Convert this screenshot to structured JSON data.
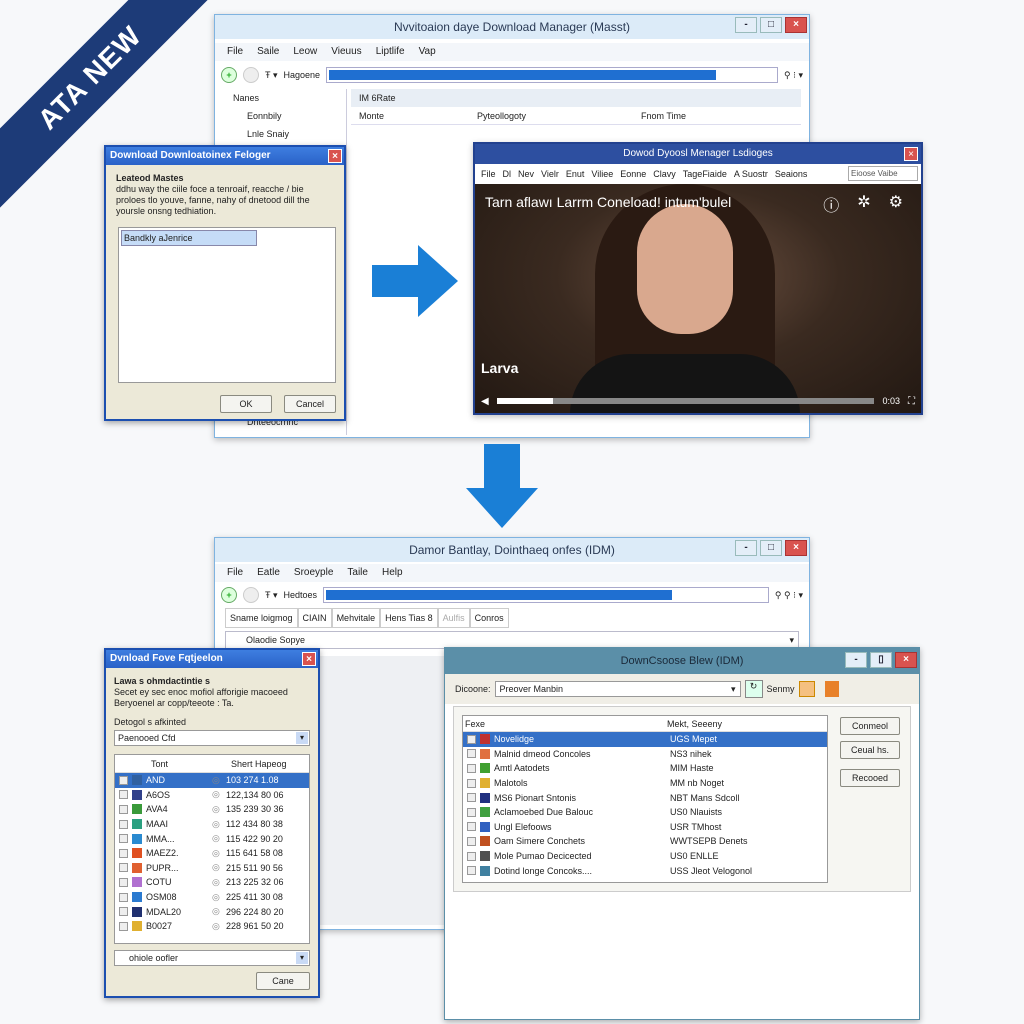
{
  "banner": {
    "text": "ATA NEW"
  },
  "top_window": {
    "title": "Nvvitoaion daye Download Manager  (Masst)",
    "menu": [
      "File",
      "Saile",
      "Leow",
      "Vieuus",
      "Liptlife",
      "Vap"
    ],
    "toolbar_label": "Hagoene",
    "progress": 0.88,
    "tree": [
      "Nanes",
      "Eonnbily",
      "Lnle Snaiy",
      "Dnteeocrnnc"
    ],
    "content_header": "IM 6Rate",
    "columns": [
      "Monte",
      "Pyteollogoty",
      "Fnom Time"
    ]
  },
  "dialog1": {
    "title": "Download Downloatoinex Feloger",
    "heading": "Leateod Mastes",
    "description": "ddhu way the ciile foce a tenroaif, reacche / bie proloes tlo youve, fanne, nahy of dnetood dill the yoursle onsng tedhiation.",
    "list_item": "Bandkly aJenrice",
    "ok": "OK",
    "cancel": "Cancel"
  },
  "video_window": {
    "title": "Dowod Dyoosl Menager Lsdioges",
    "menu": [
      "File",
      "Dl",
      "Nev",
      "Vielr",
      "Enut",
      "Viliee",
      "Eonne",
      "Clavy",
      "TageFiaide",
      "A Suostr",
      "Seaions"
    ],
    "search": "Eioose Vaibe",
    "overlay_title": "Tarn aflawı Larrm Coneload! intum'bulel",
    "caption": "Larva",
    "progress": 0.15,
    "time": "0:03"
  },
  "bottom_window": {
    "title": "Damor Bantlay, Dointhaeq onfes (IDM)",
    "menu": [
      "File",
      "Eatle",
      "Sroeyple",
      "Taile",
      "Help"
    ],
    "toolbar_label": "Hedtoes",
    "progress": 0.83,
    "tabs": [
      "Sname loigmog",
      "CIAIN",
      "Mehvitale",
      "Hens Tias 8",
      "Aulfis",
      "Conros"
    ],
    "address": "Olaodie Sopye"
  },
  "dialog2": {
    "title": "Dvnload Fove Fqtjeelon",
    "heading": "Lawa s ohmdactintie s",
    "description": "Secet ey sec enoc mofiol afforigie macoeed Beryoenel ar copp/teeote : Ta.",
    "field_label": "Detogol s afkinted",
    "dropdown": "Paenooed Cfd",
    "columns": [
      "Tont",
      "Shert Hapeog"
    ],
    "rows": [
      {
        "name": "AND",
        "value": "103 274 1.08",
        "color": "#3060a0"
      },
      {
        "name": "A6OS",
        "value": "122,134 80 06",
        "color": "#30408a"
      },
      {
        "name": "AVA4",
        "value": "135 239 30 36",
        "color": "#3a9a3a"
      },
      {
        "name": "MAAI",
        "value": "112 434 80 38",
        "color": "#2aa080"
      },
      {
        "name": "MMA...",
        "value": "115 422 90 20",
        "color": "#2a8ad0"
      },
      {
        "name": "MAEZ2.",
        "value": "115 641 58 08",
        "color": "#e05020"
      },
      {
        "name": "PUPR...",
        "value": "215 511 90 56",
        "color": "#e06030"
      },
      {
        "name": "COTU",
        "value": "213 225 32 06",
        "color": "#b070d0"
      },
      {
        "name": "OSM08",
        "value": "225 411 30 08",
        "color": "#2a7ad0"
      },
      {
        "name": "MDAL20",
        "value": "296 224 80 20",
        "color": "#203070"
      },
      {
        "name": "B0027",
        "value": "228 961 50 20",
        "color": "#e0b030"
      }
    ],
    "bottom_dropdown": "ohiole oofler",
    "cancel": "Cane"
  },
  "dialog3": {
    "title": "DownCsoose Blew (IDM)",
    "field_label": "Dicoone:",
    "dropdown": "Preover Manbin",
    "secondary_label": "Senmy",
    "columns": [
      "Fexe",
      "Mekt, Seeeny"
    ],
    "rows": [
      {
        "name": "Novelidge",
        "value": "UGS Mepet",
        "color": "#c03030"
      },
      {
        "name": "Malnid dmeod Concoles",
        "value": "NS3 nihek",
        "color": "#e07040"
      },
      {
        "name": "Amtl Aatodets",
        "value": "MIM Haste",
        "color": "#40a030"
      },
      {
        "name": "Malotols",
        "value": "MM nb Noget",
        "color": "#e0b030"
      },
      {
        "name": "MS6 Pionart Sntonis",
        "value": "NBT Mans Sdcoll",
        "color": "#203080"
      },
      {
        "name": "Aclamoebed Due Balouc",
        "value": "US0 Nlauists",
        "color": "#40a040"
      },
      {
        "name": "Ungl Elefoows",
        "value": "USR TMhost",
        "color": "#3060c0"
      },
      {
        "name": "Oam Simere Conchets",
        "value": "WWTSEPB Denets",
        "color": "#c05020"
      },
      {
        "name": "Mole Pumao Decicected",
        "value": "US0 ENLLE",
        "color": "#505050"
      },
      {
        "name": "Dotind longe Concoks....",
        "value": "USS Jleot Velogonol",
        "color": "#4080a0"
      }
    ],
    "buttons": [
      "Conmeol",
      "Ceual hs.",
      "Recooed"
    ]
  }
}
